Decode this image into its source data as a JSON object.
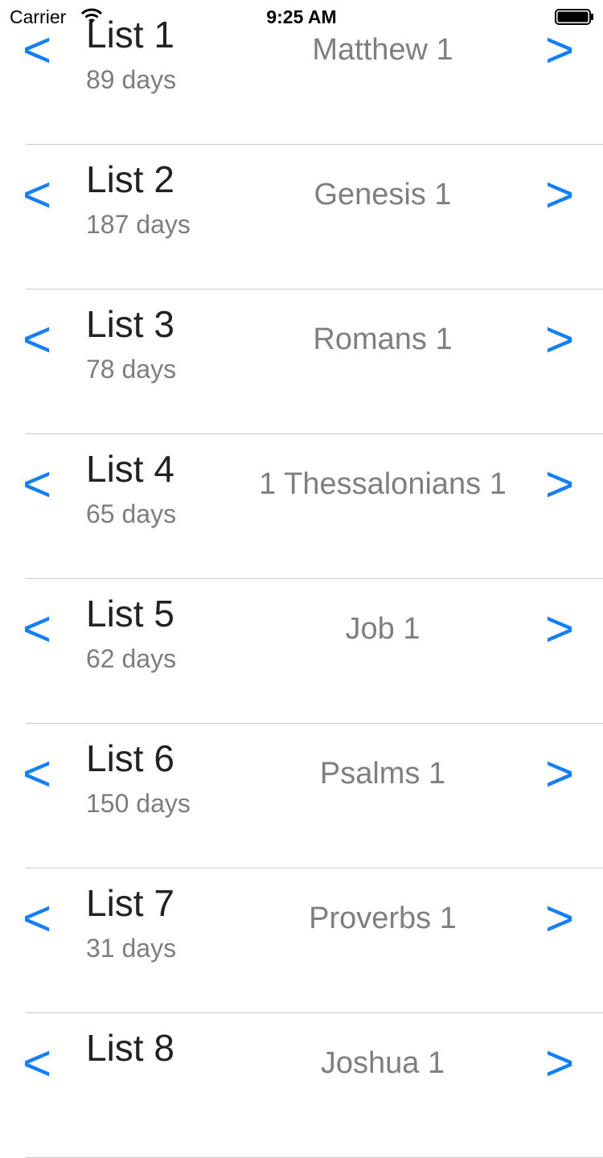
{
  "status_bar": {
    "carrier": "Carrier",
    "time": "9:25 AM"
  },
  "nav": {
    "prev_label": "<",
    "next_label": ">"
  },
  "lists": [
    {
      "name": "List 1",
      "days": "89 days",
      "chapter": "Matthew 1"
    },
    {
      "name": "List 2",
      "days": "187 days",
      "chapter": "Genesis 1"
    },
    {
      "name": "List 3",
      "days": "78 days",
      "chapter": "Romans 1"
    },
    {
      "name": "List 4",
      "days": "65 days",
      "chapter": "1 Thessalonians 1"
    },
    {
      "name": "List 5",
      "days": "62 days",
      "chapter": "Job 1"
    },
    {
      "name": "List 6",
      "days": "150 days",
      "chapter": "Psalms 1"
    },
    {
      "name": "List 7",
      "days": "31 days",
      "chapter": "Proverbs 1"
    },
    {
      "name": "List 8",
      "days": "",
      "chapter": "Joshua 1"
    }
  ],
  "colors": {
    "accent": "#157efb",
    "title_text": "#222222",
    "secondary_text": "#7d7d7d",
    "divider": "#c8c7cc"
  }
}
